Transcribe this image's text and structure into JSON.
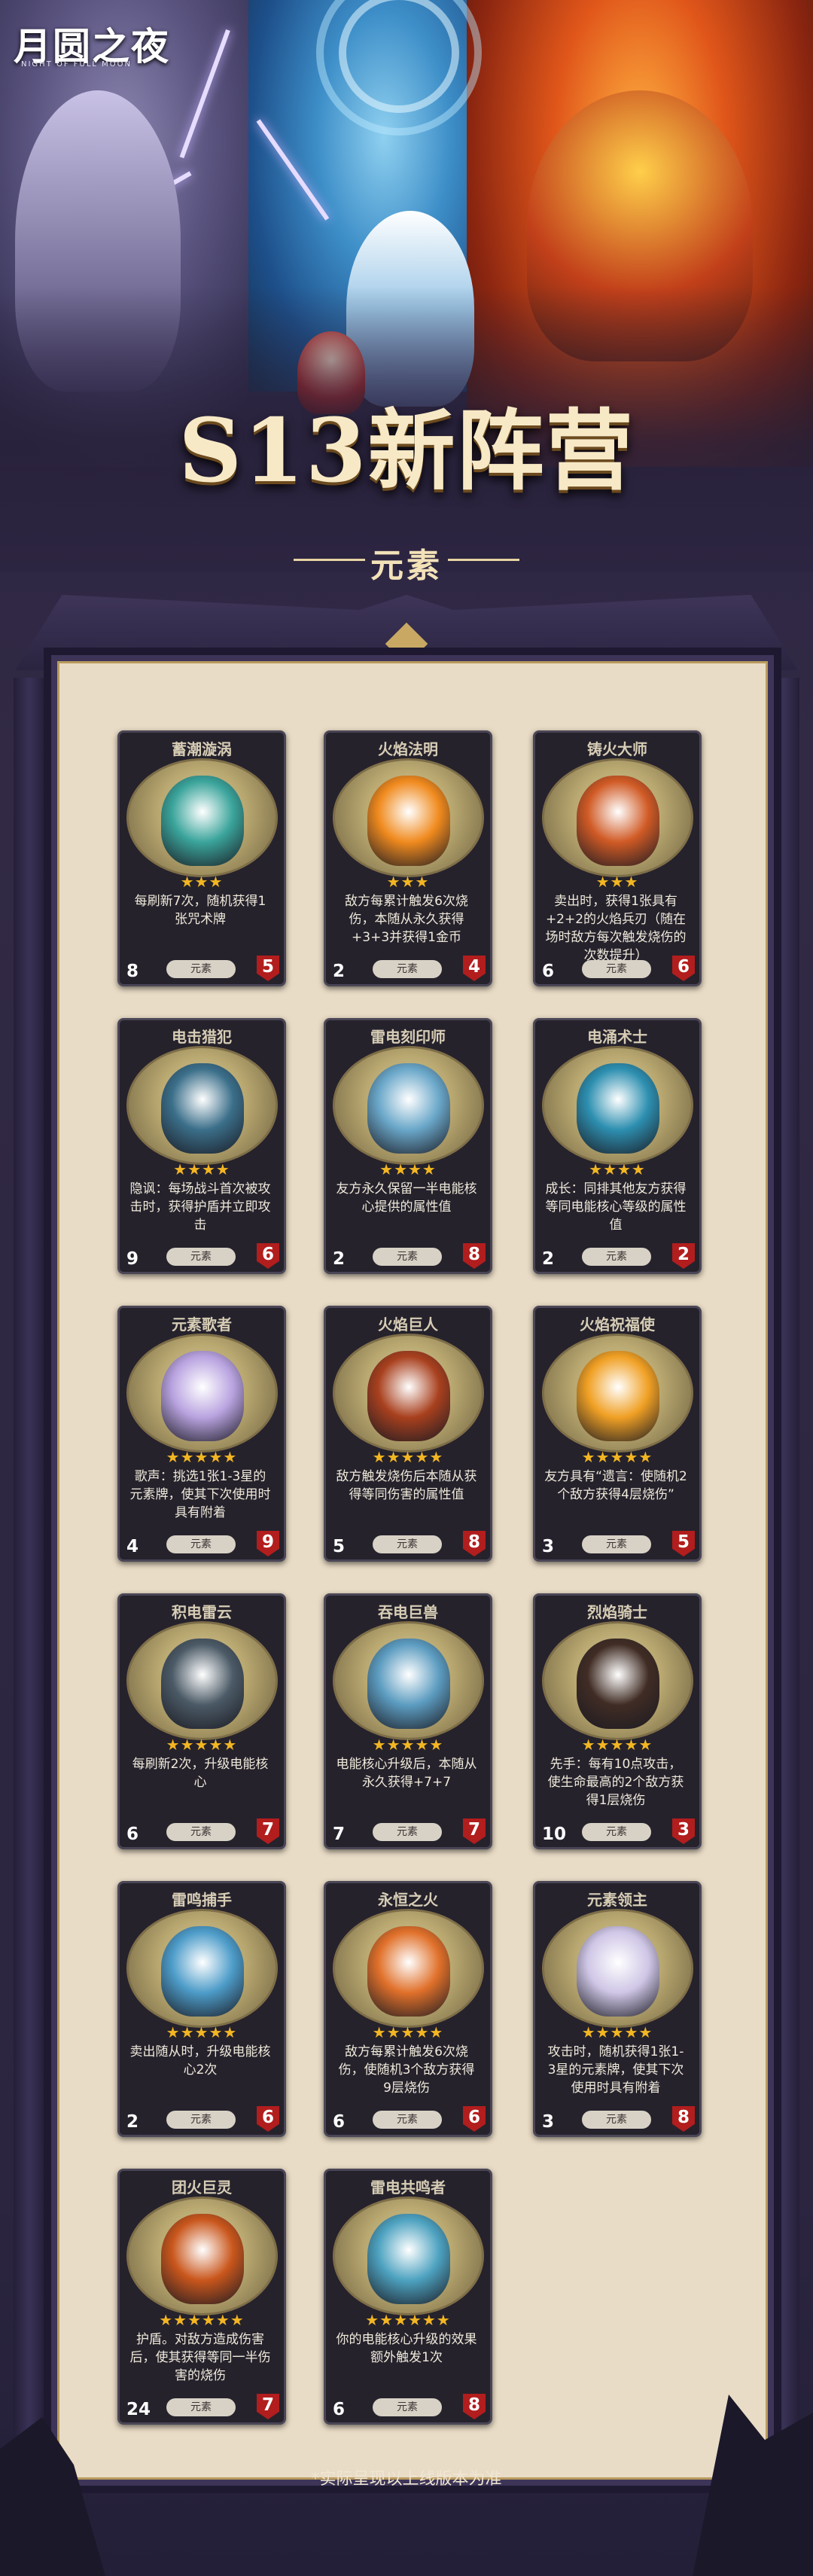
{
  "logo": {
    "main": "月圆之夜",
    "sub": "NIGHT OF FULL MOON"
  },
  "header": {
    "title": "S13新阵营",
    "subtitle": "元素"
  },
  "colors": {
    "accent_gold": "#f3b622",
    "accent_blue": "#58c7f2",
    "hp_red": "#b21d1d",
    "frame": "#e9dcc6"
  },
  "cards": [
    {
      "name": "蓄潮漩涡",
      "stars": "★★★",
      "desc": "每刷新7次，随机获得1张咒术牌",
      "atk": "8",
      "hp": "5",
      "tag": "元素",
      "art": "#3aa49b"
    },
    {
      "name": "火焰法明",
      "stars": "★★★",
      "desc": "敌方每累计触发6次烧伤，本随从永久获得+3+3并获得1金币",
      "atk": "2",
      "hp": "4",
      "tag": "元素",
      "art": "#f08a1e"
    },
    {
      "name": "铸火大师",
      "stars": "★★★",
      "desc": "卖出时，获得1张具有+2+2的火焰兵刃（随在场时敌方每次触发烧伤的次数提升）",
      "atk": "6",
      "hp": "6",
      "tag": "元素",
      "art": "#d05a25"
    },
    {
      "name": "电击猎犯",
      "stars": "★★★★",
      "desc": "隐讽：每场战斗首次被攻击时，获得护盾并立即攻击",
      "atk": "9",
      "hp": "6",
      "tag": "元素",
      "art": "#3b6f8a"
    },
    {
      "name": "雷电刻印师",
      "stars": "★★★★",
      "desc": "友方永久保留一半电能核心提供的属性值",
      "atk": "2",
      "hp": "8",
      "tag": "元素",
      "art": "#6aa7c9"
    },
    {
      "name": "电涌术士",
      "stars": "★★★★",
      "desc": "成长：同排其他友方获得等同电能核心等级的属性值",
      "atk": "2",
      "hp": "2",
      "tag": "元素",
      "art": "#2d8fb0"
    },
    {
      "name": "元素歌者",
      "stars": "★★★★★",
      "desc": "歌声：挑选1张1-3星的元素牌，使其下次使用时具有附着",
      "atk": "4",
      "hp": "9",
      "tag": "元素",
      "art": "#b9a3e0"
    },
    {
      "name": "火焰巨人",
      "stars": "★★★★★",
      "desc": "敌方触发烧伤后本随从获得等同伤害的属性值",
      "atk": "5",
      "hp": "8",
      "tag": "元素",
      "art": "#a8401e"
    },
    {
      "name": "火焰祝福使",
      "stars": "★★★★★",
      "desc": "友方具有“遗言：使随机2个敌方获得4层烧伤”",
      "atk": "3",
      "hp": "5",
      "tag": "元素",
      "art": "#f0a024"
    },
    {
      "name": "积电雷云",
      "stars": "★★★★★",
      "desc": "每刷新2次，升级电能核心",
      "atk": "6",
      "hp": "7",
      "tag": "元素",
      "art": "#4b5a66"
    },
    {
      "name": "吞电巨兽",
      "stars": "★★★★★",
      "desc": "电能核心升级后，本随从永久获得+7+7",
      "atk": "7",
      "hp": "7",
      "tag": "元素",
      "art": "#5c9cc0"
    },
    {
      "name": "烈焰骑士",
      "stars": "★★★★★",
      "desc": "先手：每有10点攻击，使生命最高的2个敌方获得1层烧伤",
      "atk": "10",
      "hp": "3",
      "tag": "元素",
      "art": "#402c24"
    },
    {
      "name": "雷鸣捕手",
      "stars": "★★★★★",
      "desc": "卖出随从时，升级电能核心2次",
      "atk": "2",
      "hp": "6",
      "tag": "元素",
      "art": "#4d9cc9"
    },
    {
      "name": "永恒之火",
      "stars": "★★★★★",
      "desc": "敌方每累计触发6次烧伤，使随机3个敌方获得9层烧伤",
      "atk": "6",
      "hp": "6",
      "tag": "元素",
      "art": "#e0702a"
    },
    {
      "name": "元素领主",
      "stars": "★★★★★",
      "desc": "攻击时，随机获得1张1-3星的元素牌，使其下次使用时具有附着",
      "atk": "3",
      "hp": "8",
      "tag": "元素",
      "art": "#cfc6e6"
    },
    {
      "name": "团火巨灵",
      "stars": "★★★★★★",
      "desc": "护盾。对敌方造成伤害后，使其获得等同一半伤害的烧伤",
      "atk": "24",
      "hp": "7",
      "tag": "元素",
      "art": "#c9561c"
    },
    {
      "name": "雷电共鸣者",
      "stars": "★★★★★★",
      "desc": "你的电能核心升级的效果额外触发1次",
      "atk": "6",
      "hp": "8",
      "tag": "元素",
      "art": "#4da2c0"
    }
  ],
  "footnote": "*实际呈现以上线版本为准"
}
